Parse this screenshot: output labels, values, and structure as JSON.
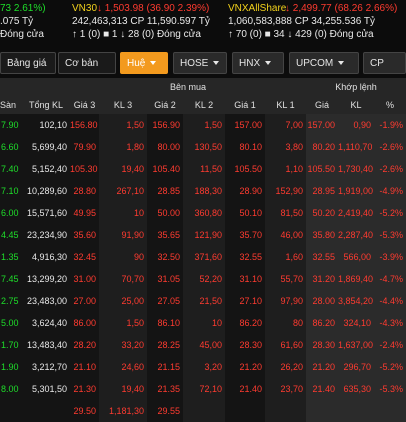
{
  "header": {
    "line1": [
      {
        "text": "73 2.61%)",
        "color": "green"
      },
      {
        "text": "VN30 ",
        "color": "yellow"
      },
      {
        "text": "↓ 1,503.98 (36.90 2.39%)",
        "color": "red"
      },
      {
        "text": "VNXAllShare ",
        "color": "yellow"
      },
      {
        "text": "↓ 2,499.77 (68.26 2.66%)",
        "color": "red"
      }
    ],
    "line2": [
      {
        "text": ".075 Tỷ",
        "color": "white"
      },
      {
        "text": "242,463,313 CP 11,590.597 Tỷ",
        "color": "white"
      },
      {
        "text": "1,060,583,888 CP 34,255.536 Tỷ",
        "color": "white"
      }
    ],
    "line3": [
      {
        "text": "Đóng cửa",
        "color": "white"
      },
      {
        "text": "↑ 1 (0) ■ 1 ↓ 28 (0) Đóng cửa",
        "color": "white"
      },
      {
        "text": "↑ 70 (0) ■ 34 ↓ 429 (0) Đóng cửa",
        "color": "white"
      }
    ]
  },
  "tabs": [
    {
      "label": "Bảng giá",
      "style": "plain"
    },
    {
      "label": "Cơ bản",
      "style": "plain"
    },
    {
      "label": "Huệ",
      "style": "active",
      "caret": true
    },
    {
      "label": "HOSE",
      "style": "normal",
      "caret": true
    },
    {
      "label": "HNX",
      "style": "normal",
      "caret": true
    },
    {
      "label": "UPCOM",
      "style": "normal",
      "caret": true
    },
    {
      "label": "CP Giá t",
      "style": "normal",
      "caret": false
    }
  ],
  "table": {
    "group_headers": {
      "ben_mua": "Bên mua",
      "khop_lenh": "Khớp lệnh"
    },
    "columns": [
      "Sàn",
      "Tổng KL",
      "Giá 3",
      "KL 3",
      "Giá 2",
      "KL 2",
      "Giá 1",
      "KL 1",
      "Giá",
      "KL",
      "%"
    ],
    "rows": [
      {
        "san": "7.90",
        "tong": "102,10",
        "g3": "156.80",
        "kl3": "1,50",
        "g2": "156.90",
        "kl2": "1,50",
        "g1": "157.00",
        "kl1": "7,00",
        "gia": "157.00",
        "kl": "0,90",
        "pct": "-1.9%"
      },
      {
        "san": "6.60",
        "tong": "5,699,40",
        "g3": "79.90",
        "kl3": "1,80",
        "g2": "80.00",
        "kl2": "130,50",
        "g1": "80.10",
        "kl1": "3,80",
        "gia": "80.20",
        "kl": "1,110,70",
        "pct": "-2.6%"
      },
      {
        "san": "7.40",
        "tong": "5,152,40",
        "g3": "105.30",
        "kl3": "19,40",
        "g2": "105.40",
        "kl2": "11,50",
        "g1": "105.50",
        "kl1": "1,10",
        "gia": "105.50",
        "kl": "1,730,40",
        "pct": "-2.6%"
      },
      {
        "san": "7.10",
        "tong": "10,289,60",
        "g3": "28.80",
        "kl3": "267,10",
        "g2": "28.85",
        "kl2": "188,30",
        "g1": "28.90",
        "kl1": "152,90",
        "gia": "28.95",
        "kl": "1,919,00",
        "pct": "-4.9%"
      },
      {
        "san": "6.00",
        "tong": "15,571,60",
        "g3": "49.95",
        "kl3": "10",
        "g2": "50.00",
        "kl2": "360,80",
        "g1": "50.10",
        "kl1": "81,50",
        "gia": "50.20",
        "kl": "2,419,40",
        "pct": "-5.2%"
      },
      {
        "san": "4.45",
        "tong": "23,234,90",
        "g3": "35.60",
        "kl3": "91,90",
        "g2": "35.65",
        "kl2": "121,90",
        "g1": "35.70",
        "kl1": "46,00",
        "gia": "35.80",
        "kl": "2,287,40",
        "pct": "-5.3%"
      },
      {
        "san": "1.35",
        "tong": "4,916,30",
        "g3": "32.45",
        "kl3": "90",
        "g2": "32.50",
        "kl2": "371,60",
        "g1": "32.55",
        "kl1": "1,60",
        "gia": "32.55",
        "kl": "566,00",
        "pct": "-3.9%"
      },
      {
        "san": "7.45",
        "tong": "13,299,20",
        "g3": "31.00",
        "kl3": "70,70",
        "g2": "31.05",
        "kl2": "52,20",
        "g1": "31.10",
        "kl1": "55,70",
        "gia": "31.20",
        "kl": "1,869,40",
        "pct": "-4.7%"
      },
      {
        "san": "2.75",
        "tong": "23,483,00",
        "g3": "27.00",
        "kl3": "25,00",
        "g2": "27.05",
        "kl2": "21,50",
        "g1": "27.10",
        "kl1": "97,90",
        "gia": "28.00",
        "kl": "3,854,20",
        "pct": "-4.4%"
      },
      {
        "san": "5.00",
        "tong": "3,624,40",
        "g3": "86.00",
        "kl3": "1,50",
        "g2": "86.10",
        "kl2": "10",
        "g1": "86.20",
        "kl1": "80",
        "gia": "86.20",
        "kl": "324,10",
        "pct": "-4.3%"
      },
      {
        "san": "1.70",
        "tong": "13,483,40",
        "g3": "28.20",
        "kl3": "33,20",
        "g2": "28.25",
        "kl2": "45,00",
        "g1": "28.30",
        "kl1": "61,60",
        "gia": "28.30",
        "kl": "1,637,00",
        "pct": "-2.4%"
      },
      {
        "san": "1.90",
        "tong": "3,212,70",
        "g3": "21.10",
        "kl3": "24,60",
        "g2": "21.15",
        "kl2": "3,20",
        "g1": "21.20",
        "kl1": "26,20",
        "gia": "21.20",
        "kl": "296,70",
        "pct": "-5.2%"
      },
      {
        "san": "8.00",
        "tong": "5,301,50",
        "g3": "21.30",
        "kl3": "19,40",
        "g2": "21.35",
        "kl2": "72,10",
        "g1": "21.40",
        "kl1": "23,70",
        "gia": "21.40",
        "kl": "635,30",
        "pct": "-5.3%"
      },
      {
        "san": "",
        "tong": "",
        "g3": "29.50",
        "kl3": "1,181,30",
        "g2": "29.55",
        "kl2": "",
        "g1": "",
        "kl1": "",
        "gia": "",
        "kl": "",
        "pct": ""
      }
    ],
    "colors": {
      "price_red": "#ff3b30",
      "header_bg": "#262626",
      "khop_bg": "#2b2b2b",
      "active_tab": "#f39a1e",
      "floor_green": "#1ede2a"
    }
  }
}
